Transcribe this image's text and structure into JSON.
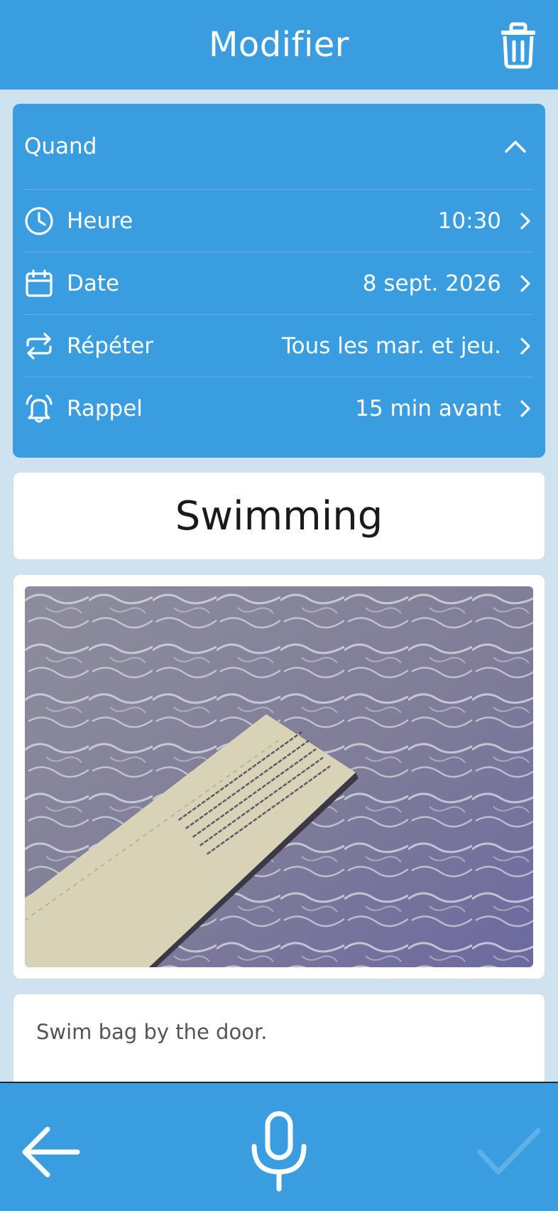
{
  "header": {
    "title": "Modifier",
    "delete_icon": "trash-icon"
  },
  "when": {
    "label": "Quand",
    "rows": [
      {
        "icon": "clock-icon",
        "label": "Heure",
        "value": "10:30"
      },
      {
        "icon": "calendar-icon",
        "label": "Date",
        "value": "8 sept. 2026"
      },
      {
        "icon": "repeat-icon",
        "label": "Répéter",
        "value": "Tous les mar. et jeu."
      },
      {
        "icon": "bell-icon",
        "label": "Rappel",
        "value": "15 min avant"
      }
    ]
  },
  "event": {
    "title": "Swimming"
  },
  "notes": {
    "text": "Swim bag by the door."
  },
  "bottom_bar": {
    "back_icon": "arrow-left-icon",
    "mic_icon": "microphone-icon",
    "confirm_icon": "checkmark-icon"
  },
  "colors": {
    "primary": "#3a9de0",
    "background": "#cfe2f0",
    "confirm_disabled": "#5fb0e8"
  }
}
